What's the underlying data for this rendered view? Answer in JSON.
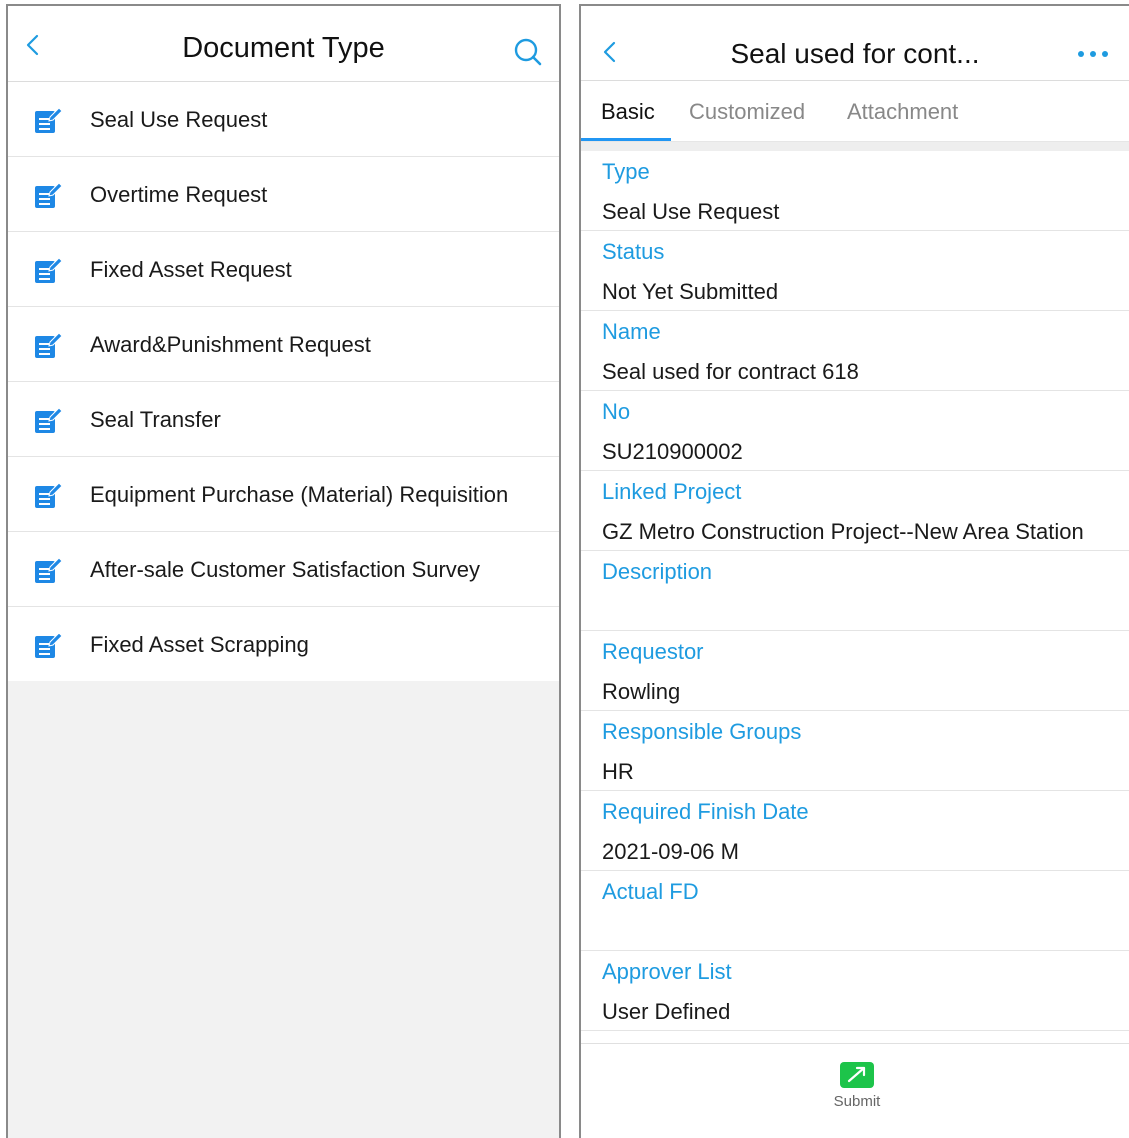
{
  "left": {
    "title": "Document Type",
    "items": [
      {
        "label": "Seal Use Request"
      },
      {
        "label": "Overtime Request"
      },
      {
        "label": "Fixed Asset Request"
      },
      {
        "label": "Award&Punishment Request"
      },
      {
        "label": "Seal Transfer"
      },
      {
        "label": "Equipment Purchase (Material) Requisition"
      },
      {
        "label": "After-sale Customer Satisfaction Survey"
      },
      {
        "label": "Fixed Asset Scrapping"
      }
    ]
  },
  "right": {
    "title": "Seal used for cont...",
    "tabs": [
      {
        "label": "Basic"
      },
      {
        "label": "Customized"
      },
      {
        "label": "Attachment"
      }
    ],
    "fields": [
      {
        "label": "Type",
        "value": "Seal Use Request"
      },
      {
        "label": "Status",
        "value": "Not Yet Submitted"
      },
      {
        "label": "Name",
        "value": "Seal used for contract 618"
      },
      {
        "label": "No",
        "value": "SU210900002"
      },
      {
        "label": "Linked Project",
        "value": "GZ Metro Construction Project--New Area Station"
      },
      {
        "label": "Description",
        "value": ""
      },
      {
        "label": "Requestor",
        "value": "Rowling"
      },
      {
        "label": "Responsible Groups",
        "value": "HR"
      },
      {
        "label": "Required Finish Date",
        "value": "2021-09-06 M"
      },
      {
        "label": "Actual FD",
        "value": ""
      },
      {
        "label": "Approver List",
        "value": "User Defined"
      }
    ],
    "submit_label": "Submit"
  },
  "icons": {
    "back": "chevron-left-icon",
    "search": "search-icon",
    "more": "more-horizontal-icon",
    "document": "document-edit-icon",
    "submit": "submit-arrow-icon"
  },
  "colors": {
    "accent": "#1e9be0",
    "tab_underline": "#2196f3",
    "submit_green": "#1dc44a"
  }
}
